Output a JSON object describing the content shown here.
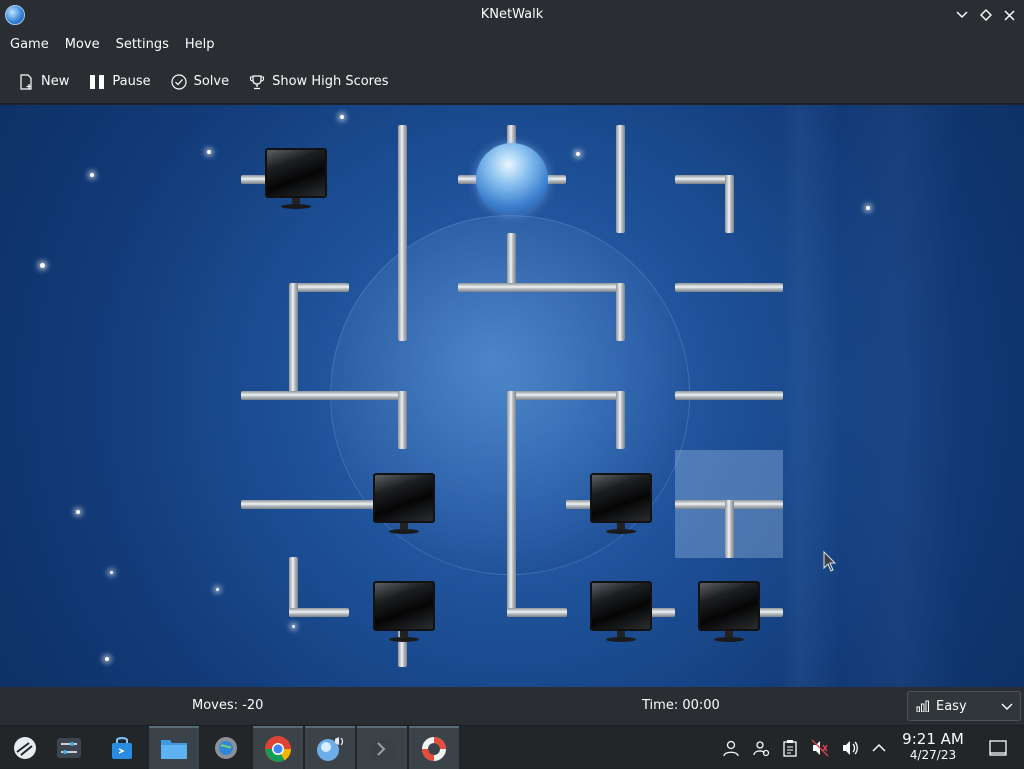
{
  "window": {
    "title": "KNetWalk",
    "minimize_glyph": "⌵",
    "maximize_glyph": "◇",
    "close_glyph": "✕"
  },
  "menu": [
    {
      "label": "Game"
    },
    {
      "label": "Move"
    },
    {
      "label": "Settings"
    },
    {
      "label": "Help"
    }
  ],
  "toolbar": {
    "new_label": "New",
    "pause_label": "Pause",
    "solve_label": "Solve",
    "scores_label": "Show High Scores"
  },
  "status": {
    "moves": "Moves: -20",
    "time": "Time: 00:00",
    "difficulty": "Easy"
  },
  "taskbar": {
    "clock_time": "9:21 AM",
    "clock_date": "4/27/23"
  },
  "colors": {
    "chrome": "#2a2e32",
    "board_blue": "#1d4f96",
    "accent": "#3daee9"
  }
}
